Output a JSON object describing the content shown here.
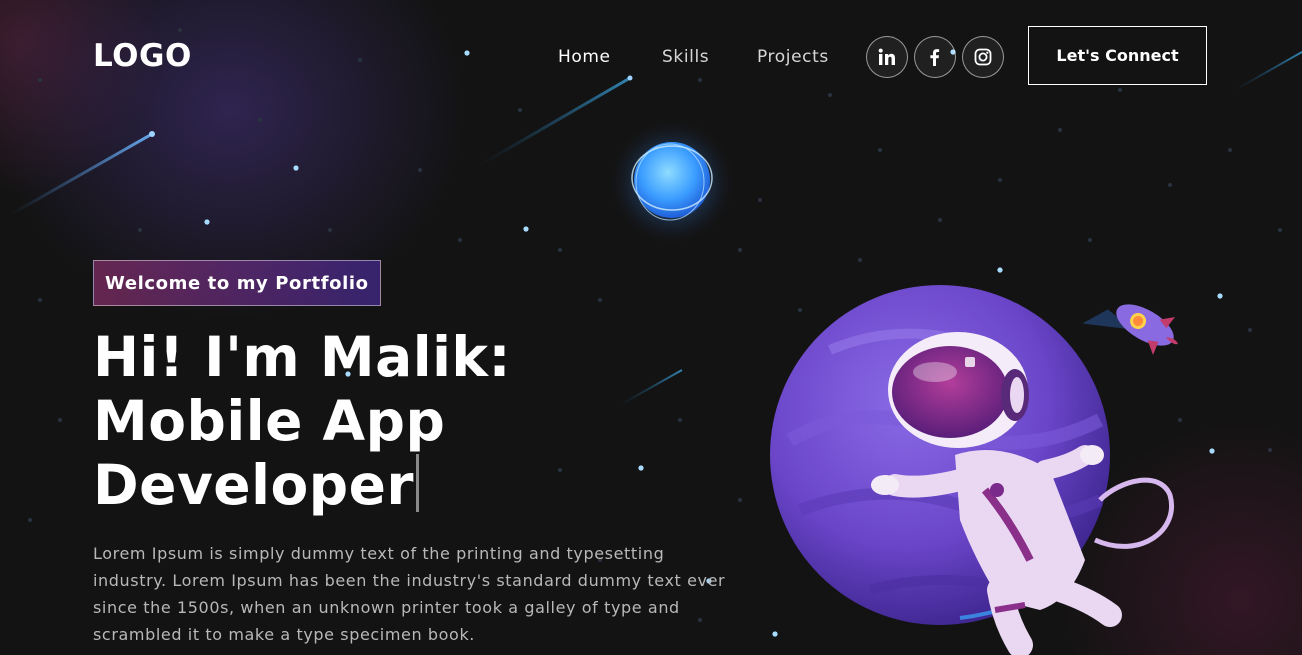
{
  "nav": {
    "logo": "LOGO",
    "links": [
      "Home",
      "Skills",
      "Projects"
    ],
    "social": [
      {
        "name": "linkedin-icon",
        "glyph": "in"
      },
      {
        "name": "facebook-icon",
        "glyph": "f"
      },
      {
        "name": "instagram-icon",
        "glyph": ""
      }
    ],
    "cta_label": "Let's Connect"
  },
  "hero": {
    "tagline": "Welcome to my Portfolio",
    "headline_lines": [
      "Hi! I'm Malik:",
      "Mobile App",
      "Developer"
    ],
    "body": "Lorem Ipsum is simply dummy text of the printing and typesetting industry. Lorem Ipsum has been the industry's standard dummy text ever since the 1500s, when an unknown printer took a galley of type and scrambled it to make a type specimen book."
  },
  "colors": {
    "background": "#121212",
    "accent_pink": "#aa367c",
    "accent_purple": "#4a2fbd",
    "planet": "#6a45c8",
    "moon_glow": "#4aa8ff"
  }
}
